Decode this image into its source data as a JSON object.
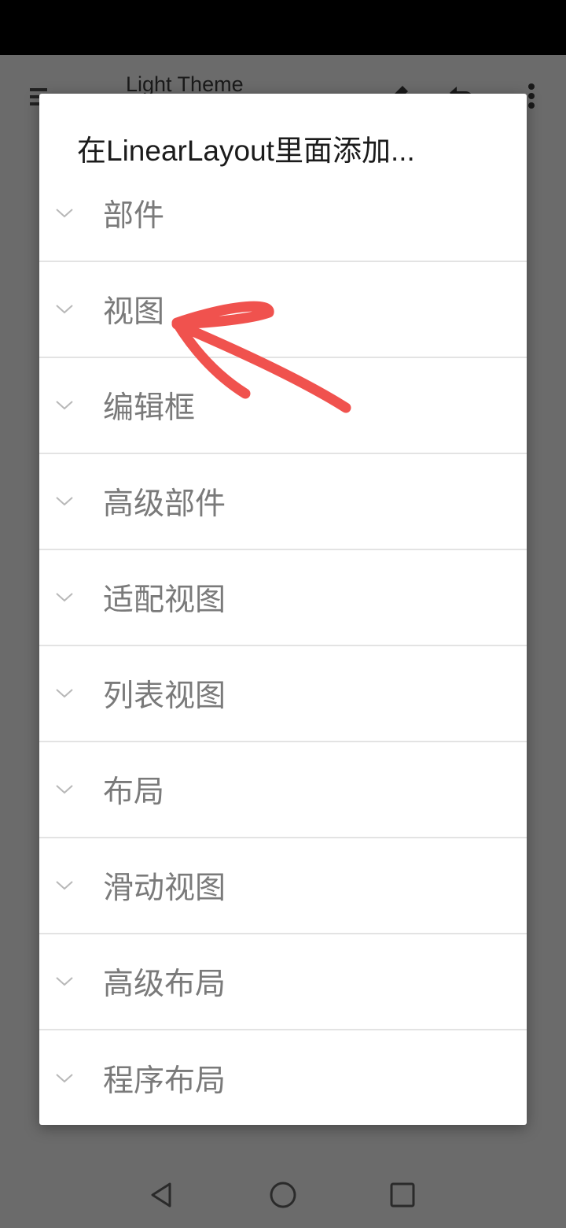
{
  "toolbar": {
    "title": "Light Theme",
    "icons": [
      "menu-icon",
      "pencil-icon",
      "undo-icon",
      "more-vert-icon"
    ]
  },
  "dialog": {
    "title": "在LinearLayout里面添加...",
    "items": [
      {
        "label": "部件"
      },
      {
        "label": "视图"
      },
      {
        "label": "编辑框"
      },
      {
        "label": "高级部件"
      },
      {
        "label": "适配视图"
      },
      {
        "label": "列表视图"
      },
      {
        "label": "布局"
      },
      {
        "label": "滑动视图"
      },
      {
        "label": "高级布局"
      },
      {
        "label": "程序布局"
      }
    ]
  },
  "annotation": {
    "color": "#f0524e",
    "points_to": "视图"
  },
  "colors": {
    "overlay": "#6b6b6b",
    "dialog_bg": "#ffffff",
    "item_text": "#7a7a7a",
    "divider": "#e3e3e3"
  },
  "navbar": {
    "icons": [
      "back-icon",
      "home-icon",
      "recents-icon"
    ]
  }
}
